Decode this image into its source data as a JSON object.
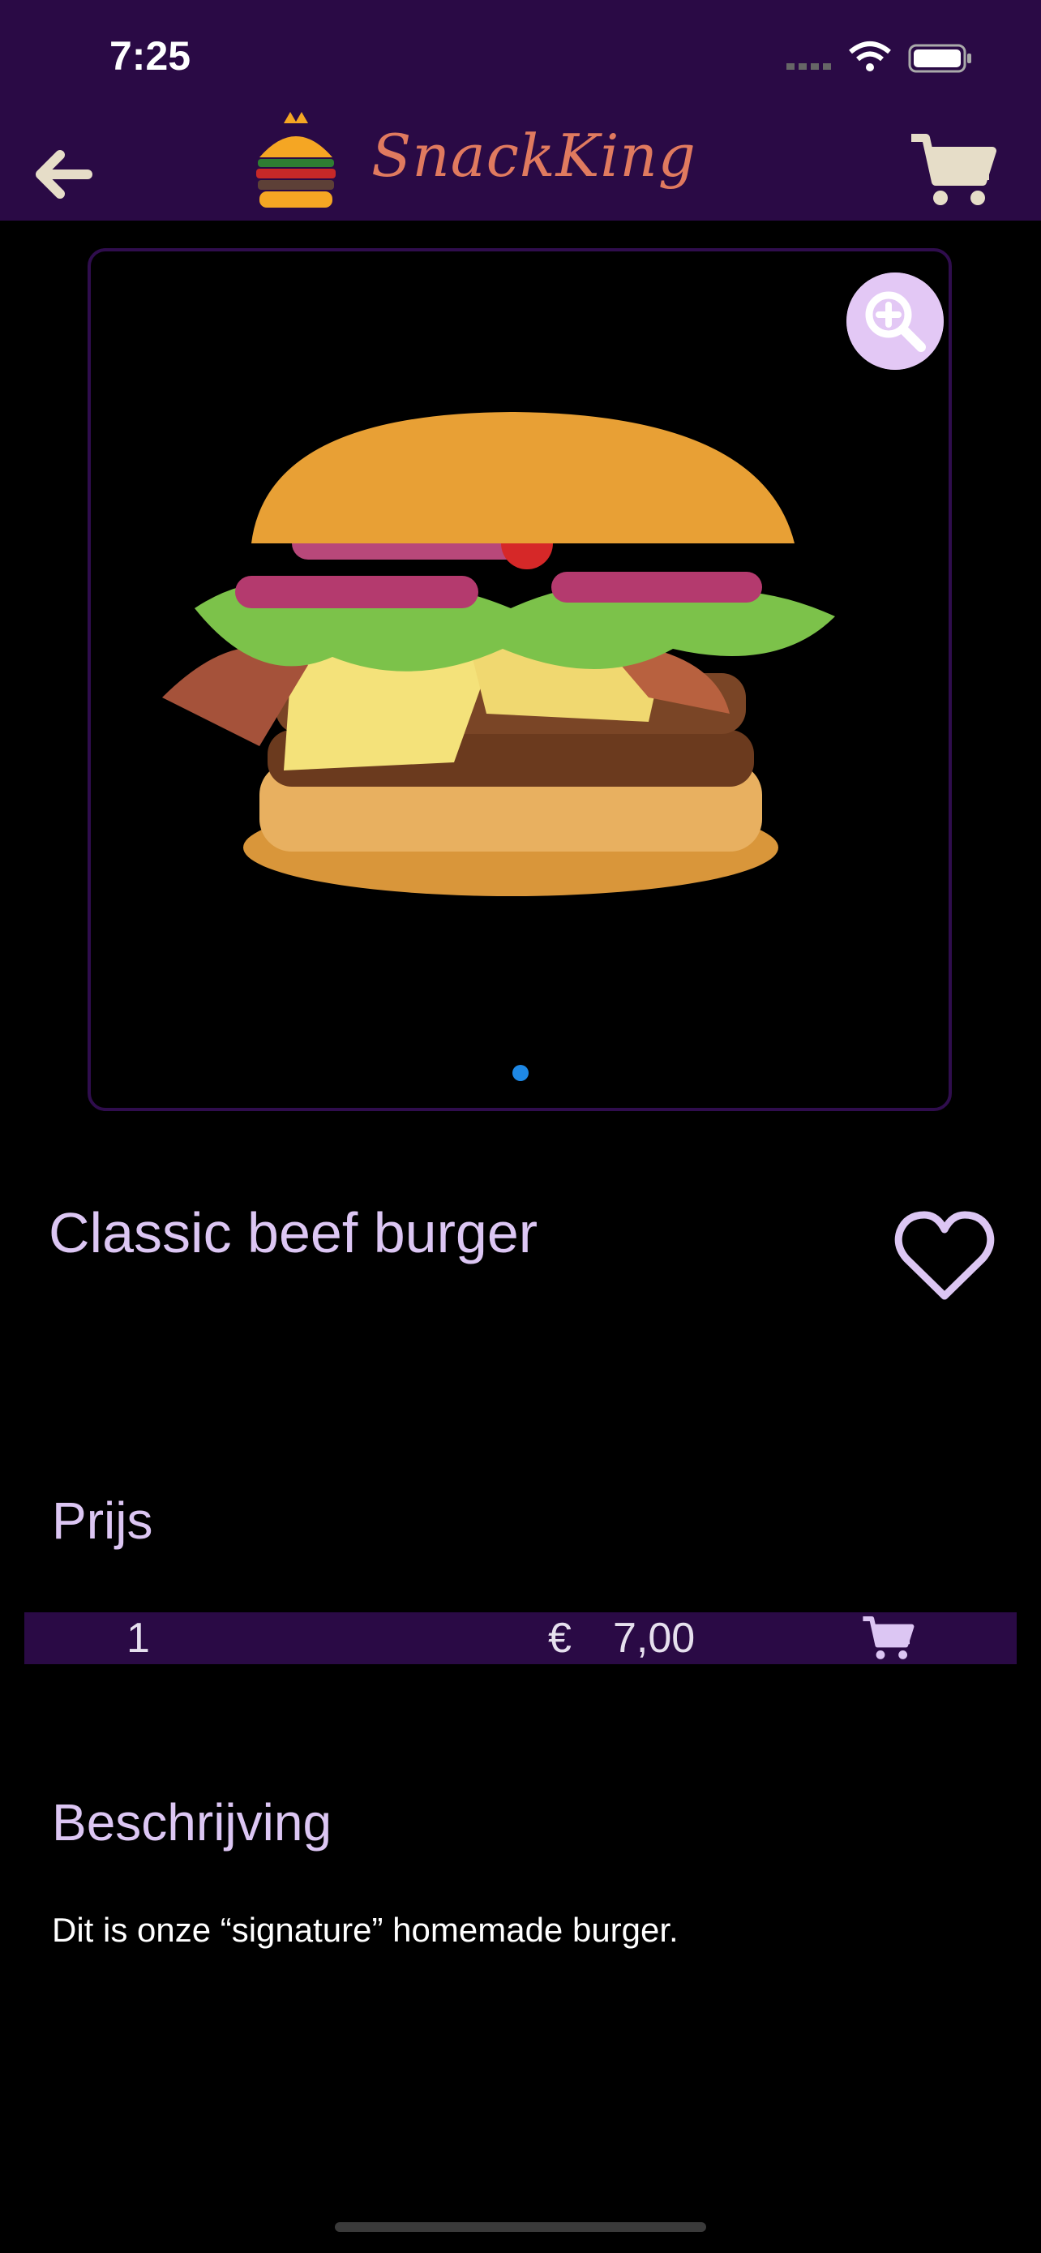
{
  "status": {
    "time": "7:25"
  },
  "header": {
    "brand": "SnackKing"
  },
  "product": {
    "title": "Classic beef burger",
    "price_label": "Prijs",
    "quantity": "1",
    "currency": "€",
    "price": "7,00",
    "description_label": "Beschrijving",
    "description": "Dit is onze “signature” homemade burger."
  },
  "colors": {
    "header_bg": "#2a0a45",
    "accent_text": "#dcc6f3",
    "brand": "#e07a5f",
    "dot": "#1e88e5"
  },
  "icons": [
    "back-arrow-icon",
    "burger-logo-icon",
    "cart-icon",
    "zoom-in-icon",
    "heart-icon",
    "add-to-cart-icon"
  ]
}
